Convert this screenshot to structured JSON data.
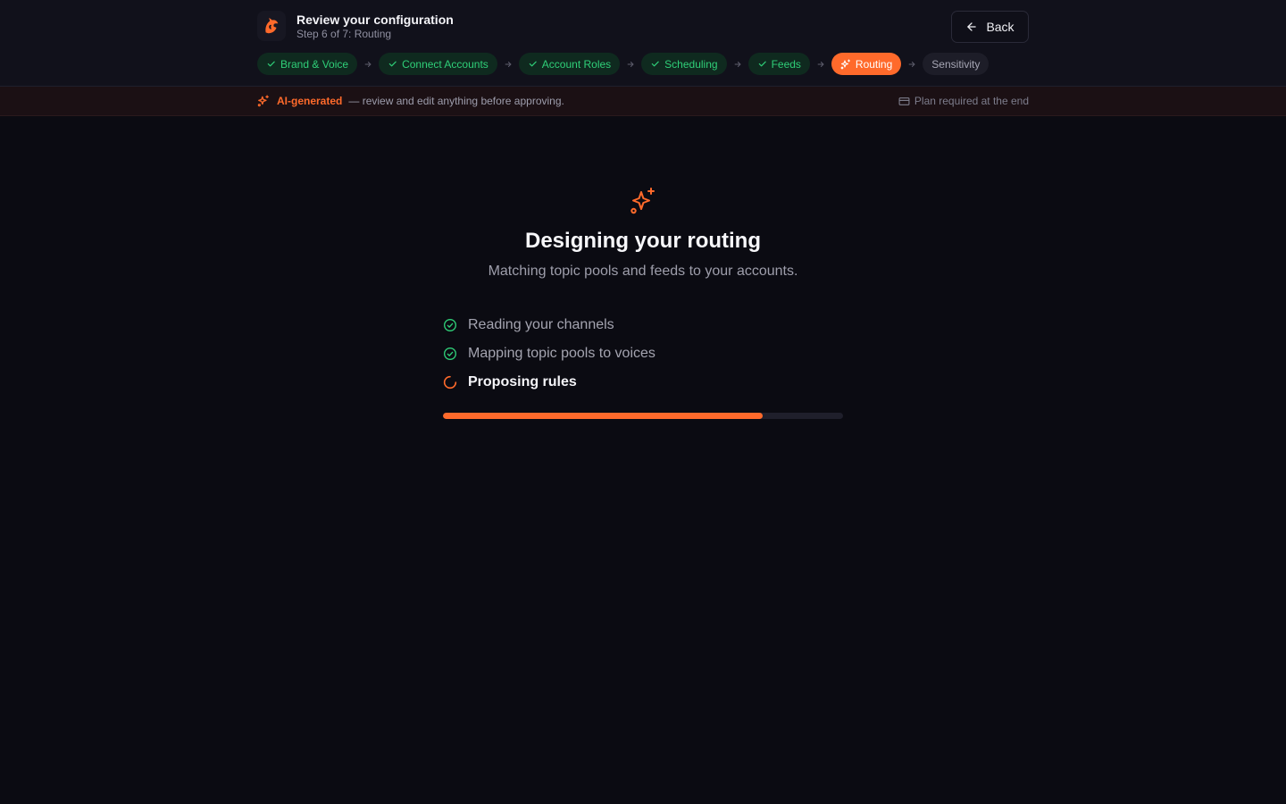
{
  "header": {
    "title": "Review your configuration",
    "subtitle": "Step 6 of 7: Routing",
    "back_label": "Back"
  },
  "steps": [
    {
      "label": "Brand & Voice",
      "state": "done"
    },
    {
      "label": "Connect Accounts",
      "state": "done"
    },
    {
      "label": "Account Roles",
      "state": "done"
    },
    {
      "label": "Scheduling",
      "state": "done"
    },
    {
      "label": "Feeds",
      "state": "done"
    },
    {
      "label": "Routing",
      "state": "active"
    },
    {
      "label": "Sensitivity",
      "state": "pending"
    }
  ],
  "banner": {
    "ai_label": "AI-generated",
    "ai_text": "— review and edit anything before approving.",
    "plan_text": "Plan required at the end"
  },
  "main": {
    "heading": "Designing your routing",
    "subheading": "Matching topic pools and feeds to your accounts.",
    "tasks": [
      {
        "label": "Reading your channels",
        "state": "done"
      },
      {
        "label": "Mapping topic pools to voices",
        "state": "done"
      },
      {
        "label": "Proposing rules",
        "state": "in-progress"
      }
    ],
    "progress_percent": 80
  },
  "colors": {
    "accent": "#ff6a2b",
    "success": "#2fcf78",
    "background": "#0b0b12"
  }
}
